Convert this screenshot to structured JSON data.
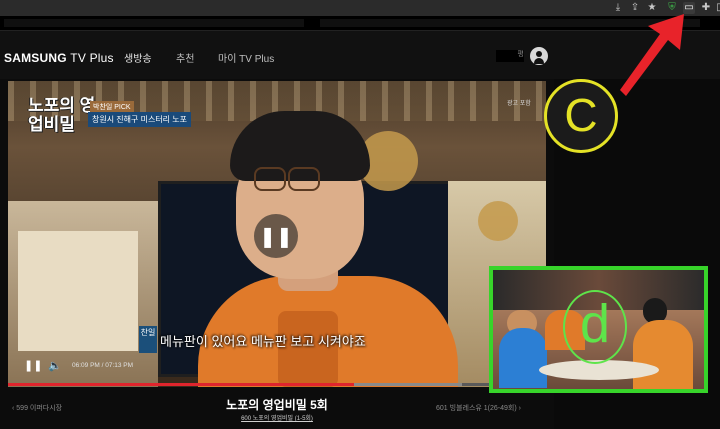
{
  "browser": {
    "extensions": [
      "download-icon",
      "share-icon",
      "star-icon",
      "shield-extension-icon",
      "media-extension-icon",
      "puzzle-icon",
      "sidebar-icon"
    ]
  },
  "site": {
    "logo_brand": "SAMSUNG",
    "logo_product": "TV Plus",
    "nav": [
      "생방송",
      "추천",
      "마이 TV Plus"
    ],
    "user_suffix": "평"
  },
  "player": {
    "show_logo": "노포의 영업비밀",
    "pick_tag": "박찬일 PICK",
    "pick_subtitle": "창원시 진해구 미스터리 노포",
    "ad_label": "광고 포함",
    "speaker_tag": "찬일",
    "subtitle": "메뉴판이 있어요 메뉴판 보고 시켜야죠",
    "time": "06:09 PM / 07:13 PM",
    "progress_fraction": 0.643
  },
  "annotations": {
    "big_letter": "C",
    "pip_letter": "d",
    "arrow_color": "#e8232a",
    "circle_color": "#e4e226",
    "pip_border_color": "#37d42a"
  },
  "program": {
    "title": "노포의 영업비밀 5회",
    "subtitle": "600 노포의 영업비밀 (1-5회)",
    "prev": "599 이퍼다시장",
    "next": "601 빙블레스유 1(26-49회)"
  }
}
